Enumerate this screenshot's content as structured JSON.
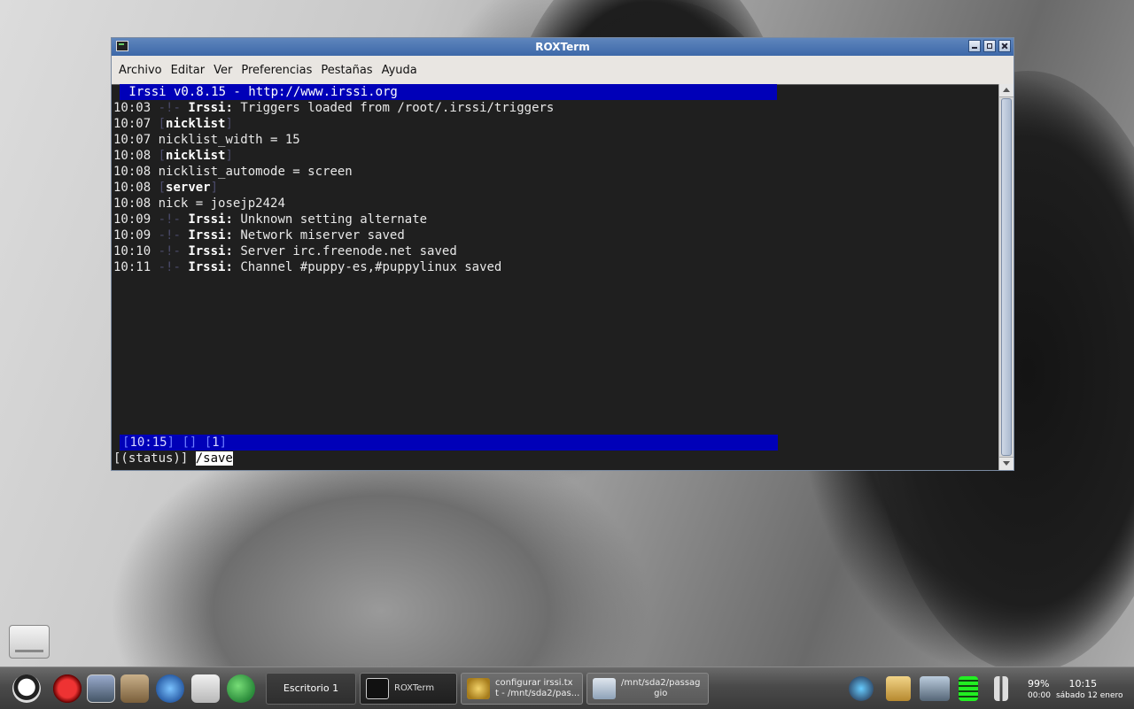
{
  "window": {
    "title": "ROXTerm",
    "menu": [
      "Archivo",
      "Editar",
      "Ver",
      "Preferencias",
      "Pestañas",
      "Ayuda"
    ]
  },
  "terminal": {
    "top_bar": " Irssi v0.8.15 - http://www.irssi.org",
    "lines": [
      {
        "time": "10:03",
        "text": "Triggers loaded from /root/.irssi/triggers"
      },
      {
        "time": "10:07",
        "text": "nicklist"
      },
      {
        "time": "10:07",
        "text": "nicklist_width = 15"
      },
      {
        "time": "10:08",
        "text": "nicklist"
      },
      {
        "time": "10:08",
        "text": "nicklist_automode = screen"
      },
      {
        "time": "10:08",
        "text": "server"
      },
      {
        "time": "10:08",
        "text": "nick = josejp2424"
      },
      {
        "time": "10:09",
        "text": "Unknown setting alternate"
      },
      {
        "time": "10:09",
        "text": "Network miserver saved"
      },
      {
        "time": "10:10",
        "text": "Server irc.freenode.net saved"
      },
      {
        "time": "10:11",
        "text": "Channel #puppy-es,#puppylinux saved"
      }
    ],
    "status_time": "10:15",
    "status_window": "1",
    "prompt_label": "[(status)] ",
    "command": "/save"
  },
  "taskbar": {
    "pager_label": "Escritorio 1",
    "tasks": [
      {
        "label": "ROXTerm"
      },
      {
        "label_line1": "configurar irssi.tx",
        "label_line2": "t - /mnt/sda2/pas..."
      },
      {
        "label_line1": "/mnt/sda2/passag",
        "label_line2": "gio"
      }
    ],
    "battery": "99%",
    "battery_time": "00:00",
    "time": "10:15",
    "date": "sábado 12 enero"
  },
  "colors": {
    "irssi_bar": "#0000b8",
    "title_bar": "#4a74b2",
    "taskbar": "#4a4a4a"
  }
}
